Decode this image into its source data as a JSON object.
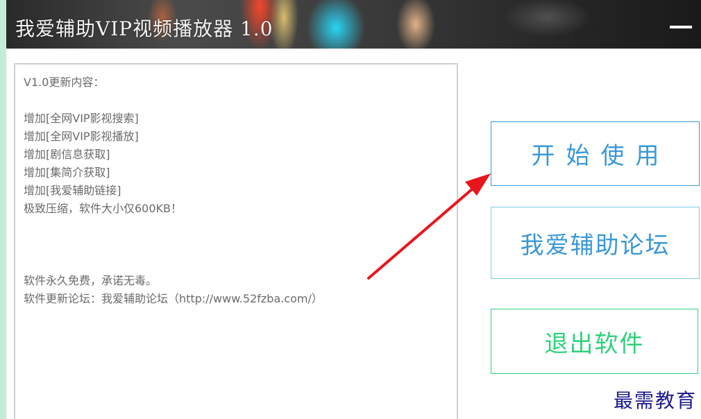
{
  "window": {
    "title": "我爱辅助VIP视频播放器 1.0",
    "minimize_icon": "minimize-icon"
  },
  "changelog": {
    "lines": [
      "V1.0更新内容：",
      "",
      "增加[全网VIP影视搜索]",
      "增加[全网VIP影视播放]",
      "增加[剧信息获取]",
      "增加[集简介获取]",
      "增加[我爱辅助链接]",
      "极致压缩，软件大小仅600KB！",
      "",
      "",
      "",
      "软件永久免费，承诺无毒。",
      "软件更新论坛：我爱辅助论坛（http://www.52fzba.com/）"
    ]
  },
  "buttons": {
    "start": "开始使用",
    "forum": "我爱辅助论坛",
    "exit": "退出软件"
  },
  "annotation": {
    "arrow_color": "#e8161a"
  },
  "watermark": "最需教育",
  "colors": {
    "start_border": "#3a98d6",
    "forum_border": "#7cc8ec",
    "exit_color": "#2ed27a",
    "watermark": "#1a1a8c"
  }
}
